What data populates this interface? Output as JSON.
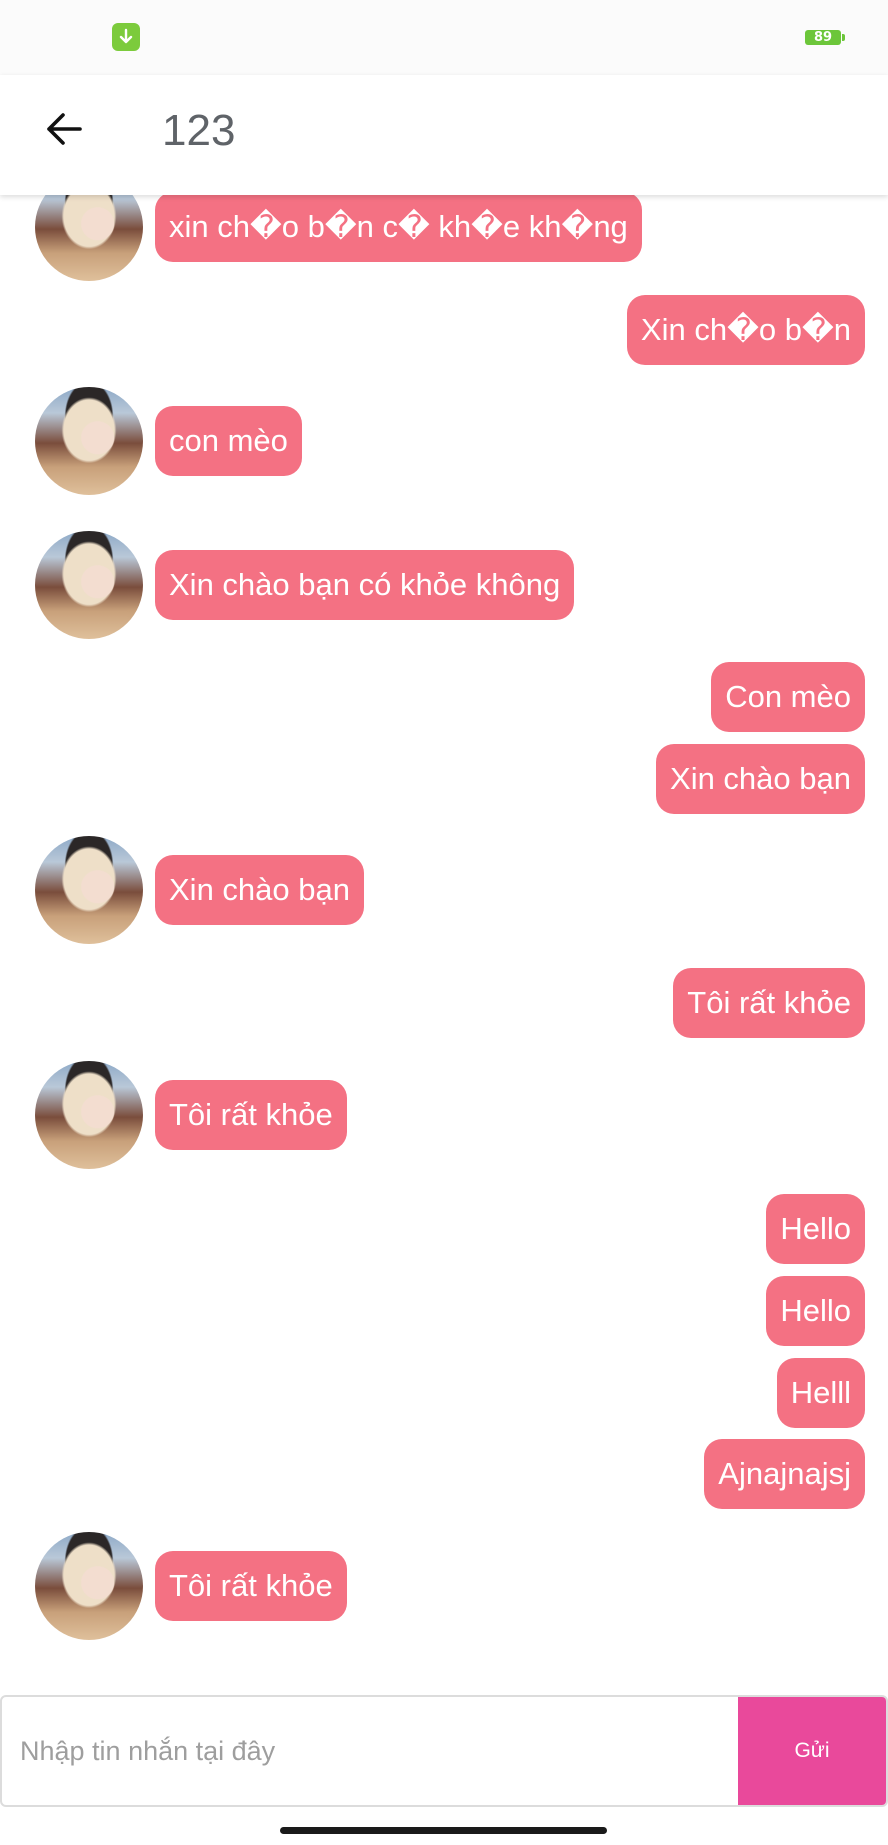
{
  "status_bar": {
    "battery_level": "89",
    "icons": [
      "download-notification-icon",
      "battery-icon"
    ]
  },
  "header": {
    "back_icon": "arrow-left-icon",
    "title": "123"
  },
  "messages": [
    {
      "side": "incoming",
      "text": "xin ch�o b�n c� kh�e kh�ng"
    },
    {
      "side": "outgoing",
      "text": "Xin ch�o b�n"
    },
    {
      "side": "incoming",
      "text": "con mèo"
    },
    {
      "side": "incoming",
      "text": "Xin chào bạn có khỏe không"
    },
    {
      "side": "outgoing",
      "text": "Con mèo"
    },
    {
      "side": "outgoing",
      "text": "Xin chào bạn"
    },
    {
      "side": "incoming",
      "text": "Xin chào bạn"
    },
    {
      "side": "outgoing",
      "text": "Tôi rất khỏe"
    },
    {
      "side": "incoming",
      "text": "Tôi rất khỏe"
    },
    {
      "side": "outgoing",
      "text": "Hello"
    },
    {
      "side": "outgoing",
      "text": "Hello"
    },
    {
      "side": "outgoing",
      "text": "Helll"
    },
    {
      "side": "outgoing",
      "text": "Ajnajnajsj"
    },
    {
      "side": "incoming",
      "text": "Tôi rất khỏe"
    }
  ],
  "composer": {
    "placeholder": "Nhập tin nhắn tại đây",
    "value": "",
    "send_label": "Gửi"
  },
  "colors": {
    "bubble": "#f47183",
    "send_button": "#e9499b",
    "status_battery": "#6cc63a"
  }
}
